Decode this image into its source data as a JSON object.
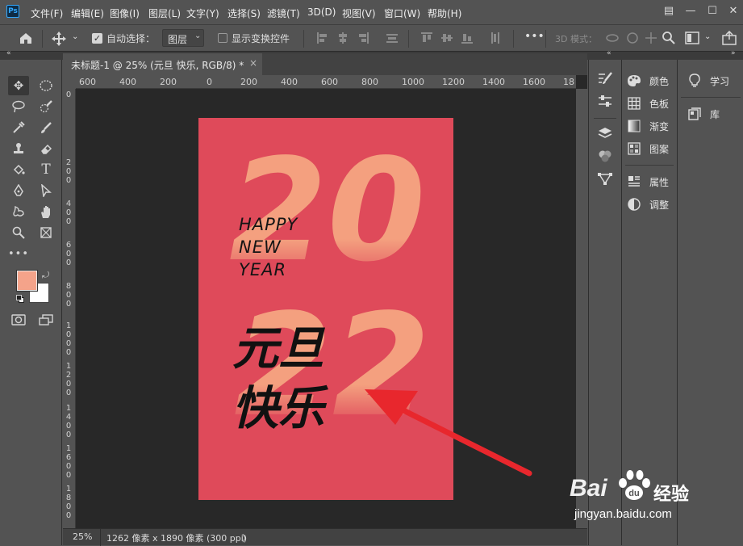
{
  "app": {
    "logo": "Ps"
  },
  "menu": [
    "文件(F)",
    "编辑(E)",
    "图像(I)",
    "图层(L)",
    "文字(Y)",
    "选择(S)",
    "滤镜(T)",
    "3D(D)",
    "视图(V)",
    "窗口(W)",
    "帮助(H)"
  ],
  "window_controls": {
    "arrange": "▤",
    "minimize": "—",
    "maximize": "☐",
    "close": "✕"
  },
  "options": {
    "auto_select_label": "自动选择：",
    "auto_select_value": "图层",
    "show_transform_label": "显示变换控件",
    "more": "•••",
    "mode_3d": "3D 模式："
  },
  "document": {
    "tab_title": "未标题-1 @ 25% (元旦    快乐, RGB/8) *",
    "close": "×"
  },
  "ruler": {
    "top": [
      "600",
      "400",
      "200",
      "0",
      "200",
      "400",
      "600",
      "800",
      "1000",
      "1200",
      "1400",
      "1600",
      "18"
    ],
    "left": [
      "0",
      "2",
      "0",
      "0",
      "4",
      "0",
      "0",
      "6",
      "0",
      "0",
      "8",
      "0",
      "0",
      "1",
      "0",
      "0",
      "0",
      "1",
      "2",
      "0",
      "0",
      "1",
      "4",
      "0",
      "0",
      "1",
      "6",
      "0",
      "0",
      "1",
      "8",
      "0",
      "0"
    ]
  },
  "poster": {
    "year_top": "20",
    "year_bottom": "22",
    "happy": "HAPPY",
    "new": "NEW",
    "year": "YEAR",
    "cn_line1": "元旦",
    "cn_line2": "快乐",
    "bg_color": "#df4a5a",
    "num_color": "#f4a07f"
  },
  "status": {
    "zoom": "25%",
    "size_info": "1262 像素 x 1890 像素 (300 ppi)",
    "arrow": "〉"
  },
  "panels": {
    "group1": [
      {
        "label": "颜色",
        "icon": "color-palette-icon"
      },
      {
        "label": "色板",
        "icon": "swatches-icon"
      },
      {
        "label": "渐变",
        "icon": "gradient-icon"
      },
      {
        "label": "图案",
        "icon": "pattern-icon"
      }
    ],
    "group2": [
      {
        "label": "属性",
        "icon": "properties-icon"
      },
      {
        "label": "调整",
        "icon": "adjustments-icon"
      }
    ],
    "group3": [
      {
        "label": "学习",
        "icon": "lightbulb-icon"
      },
      {
        "label": "库",
        "icon": "library-icon"
      }
    ]
  },
  "colors": {
    "foreground": "#f4a38a",
    "background": "#ffffff",
    "arrow": "#e8272d"
  },
  "watermark": {
    "brand_left": "Bai",
    "brand_right": "经验",
    "url": "jingyan.baidu.com"
  }
}
